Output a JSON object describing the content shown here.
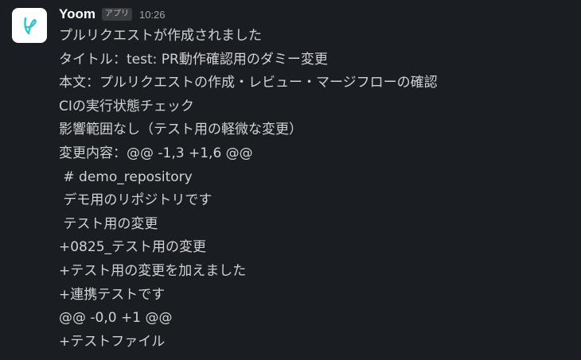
{
  "message": {
    "sender": "Yoom",
    "badge": "アプリ",
    "time": "10:26",
    "lines": [
      "プルリクエストが作成されました",
      "タイトル：test: PR動作確認用のダミー変更",
      "本文：プルリクエストの作成・レビュー・マージフローの確認",
      "CIの実行状態チェック",
      "影響範囲なし（テスト用の軽微な変更）",
      "変更内容：@@ -1,3 +1,6 @@",
      " # demo_repository",
      " デモ用のリポジトリです",
      " テスト用の変更",
      "+0825_テスト用の変更",
      "+テスト用の変更を加えました",
      "+連携テストです",
      "@@ -0,0 +1 @@",
      "+テストファイル"
    ]
  },
  "icons": {
    "avatar": "yoom-logo-icon"
  },
  "colors": {
    "background": "#1a1d21",
    "text": "#d1d2d3",
    "sender": "#ffffff",
    "brand": "#2ec4c7"
  }
}
